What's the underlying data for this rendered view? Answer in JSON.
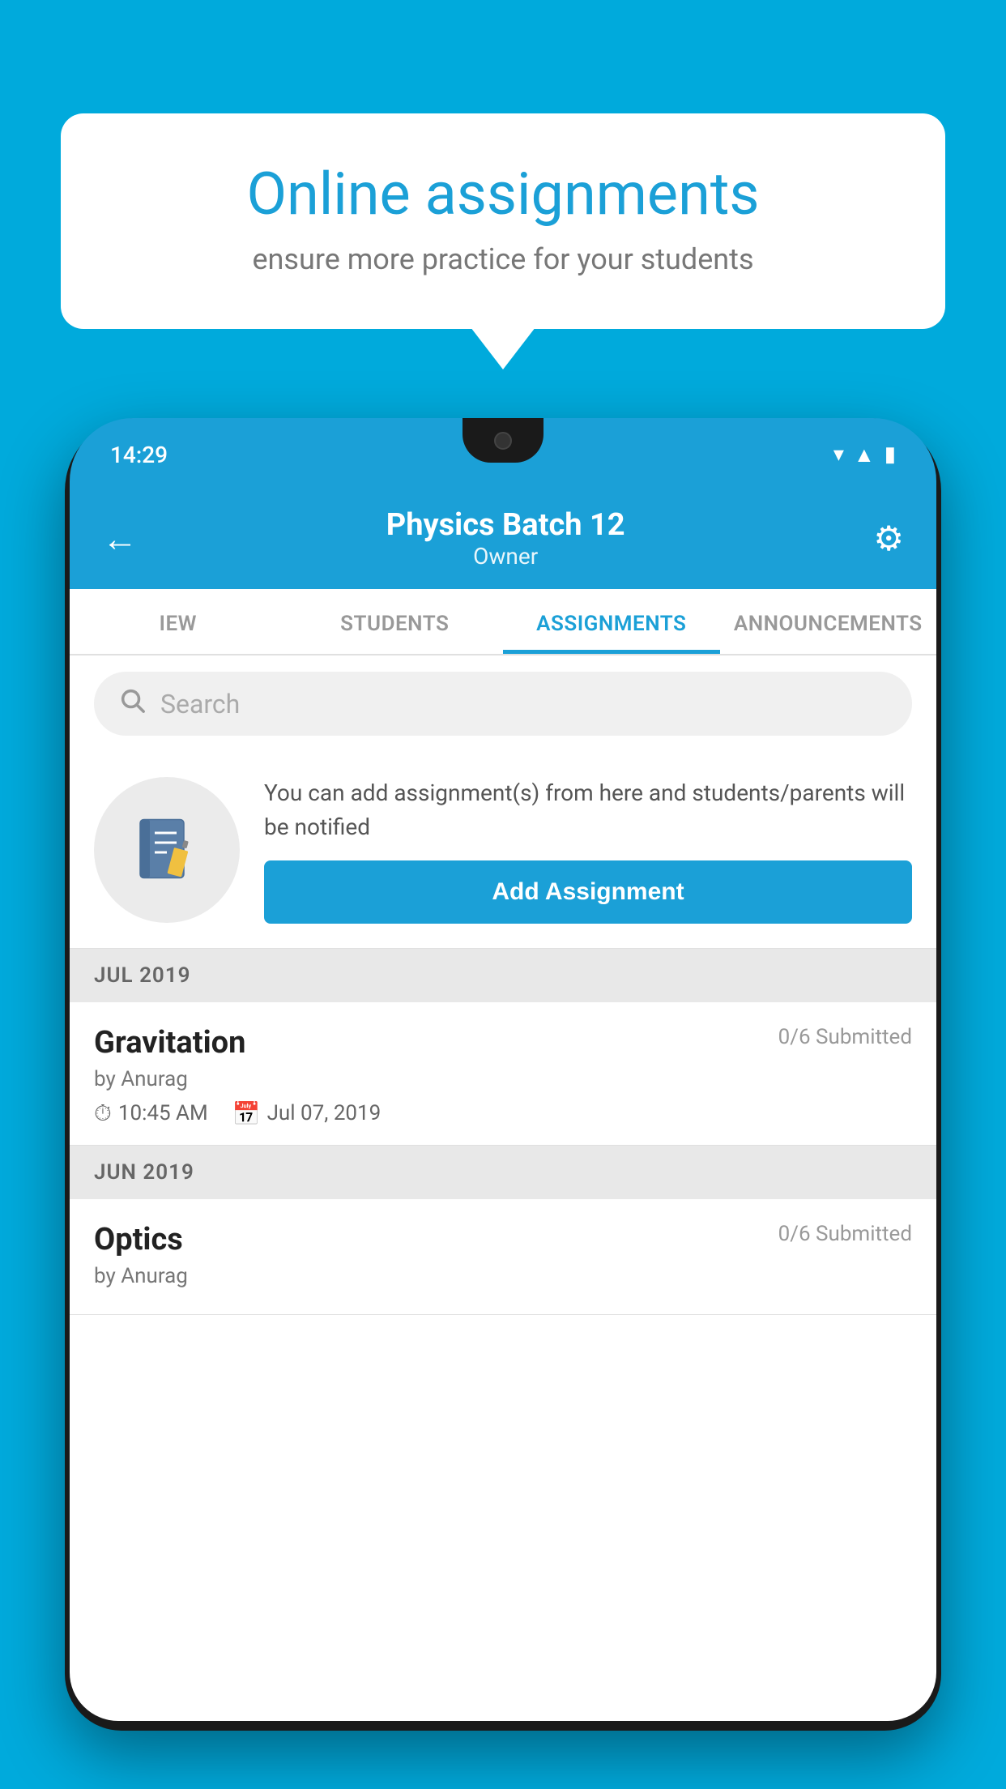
{
  "background_color": "#00AADC",
  "speech_bubble": {
    "title": "Online assignments",
    "subtitle": "ensure more practice for your students"
  },
  "phone": {
    "status_bar": {
      "time": "14:29"
    },
    "header": {
      "title": "Physics Batch 12",
      "subtitle": "Owner",
      "back_label": "←",
      "settings_label": "⚙"
    },
    "tabs": [
      {
        "label": "IEW",
        "active": false
      },
      {
        "label": "STUDENTS",
        "active": false
      },
      {
        "label": "ASSIGNMENTS",
        "active": true
      },
      {
        "label": "ANNOUNCEMENTS",
        "active": false
      }
    ],
    "search": {
      "placeholder": "Search"
    },
    "promo": {
      "text": "You can add assignment(s) from here and students/parents will be notified",
      "button_label": "Add Assignment"
    },
    "sections": [
      {
        "label": "JUL 2019",
        "assignments": [
          {
            "name": "Gravitation",
            "submitted": "0/6 Submitted",
            "by": "by Anurag",
            "time": "10:45 AM",
            "date": "Jul 07, 2019"
          }
        ]
      },
      {
        "label": "JUN 2019",
        "assignments": [
          {
            "name": "Optics",
            "submitted": "0/6 Submitted",
            "by": "by Anurag",
            "time": "",
            "date": ""
          }
        ]
      }
    ]
  }
}
